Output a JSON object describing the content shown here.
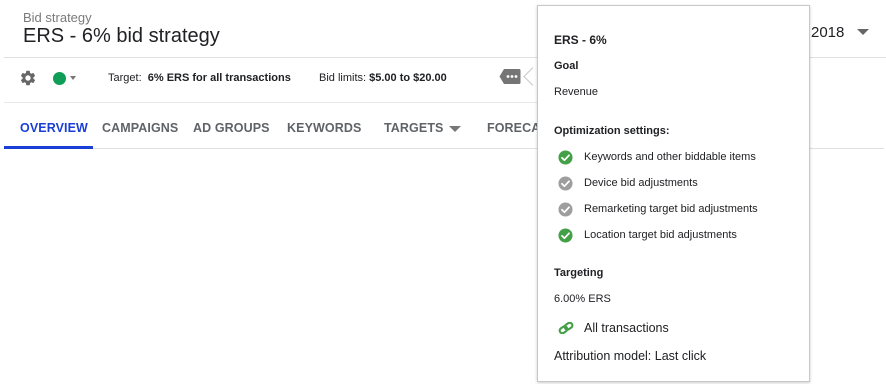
{
  "header": {
    "breadcrumb_label": "Bid strategy",
    "title": "ERS - 6% bid strategy",
    "date_fragment": "2018"
  },
  "summary": {
    "target_label": "Target:",
    "target_value": "6% ERS for all transactions",
    "bid_limits_label": "Bid limits:",
    "bid_limits_value": "$5.00 to $20.00",
    "status_color": "#0f9d58"
  },
  "tabs": [
    {
      "label": "OVERVIEW",
      "active": true
    },
    {
      "label": "CAMPAIGNS"
    },
    {
      "label": "AD GROUPS"
    },
    {
      "label": "KEYWORDS"
    },
    {
      "label": "TARGETS",
      "has_dropdown": true
    },
    {
      "label": "FORECA"
    }
  ],
  "popup": {
    "title": "ERS - 6%",
    "goal_heading": "Goal",
    "goal_value": "Revenue",
    "optimization_heading": "Optimization settings:",
    "optimization_items": [
      {
        "label": "Keywords and other biddable items",
        "icon": "check-circle-icon",
        "enabled": true
      },
      {
        "label": "Device bid adjustments",
        "icon": "check-circle-icon",
        "enabled": false
      },
      {
        "label": "Remarketing target bid adjustments",
        "icon": "check-circle-icon",
        "enabled": false
      },
      {
        "label": "Location target bid adjustments",
        "icon": "check-circle-icon",
        "enabled": true
      }
    ],
    "targeting_heading": "Targeting",
    "targeting_value": "6.00% ERS",
    "transactions_label": "All transactions",
    "attribution_label": "Attribution model: Last click"
  },
  "colors": {
    "accent": "#1a3fd6",
    "enabled": "#43a047",
    "disabled": "#9e9e9e"
  }
}
